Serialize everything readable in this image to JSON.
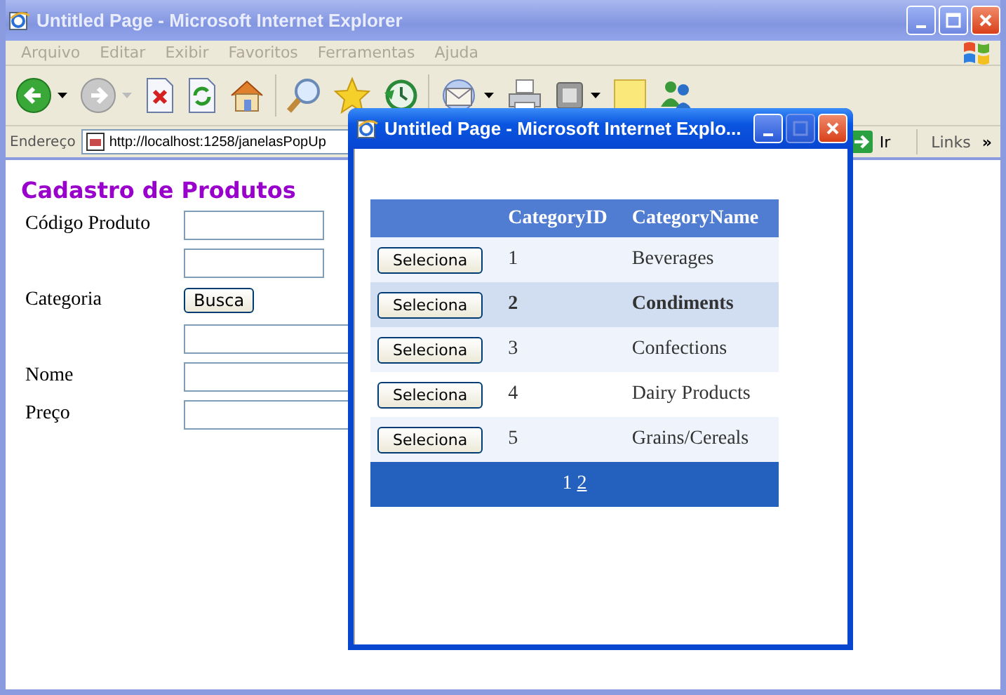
{
  "window": {
    "title": "Untitled Page - Microsoft Internet Explorer"
  },
  "menu": [
    {
      "label": "Arquivo",
      "disabled": true
    },
    {
      "label": "Editar",
      "disabled": true
    },
    {
      "label": "Exibir",
      "disabled": true
    },
    {
      "label": "Favoritos",
      "disabled": true
    },
    {
      "label": "Ferramentas",
      "disabled": true
    },
    {
      "label": "Ajuda",
      "disabled": true
    }
  ],
  "address_bar": {
    "label": "Endereço",
    "value": "http://localhost:1258/janelasPopUp",
    "go_label": "Ir",
    "links_label": "Links",
    "chevron": "»"
  },
  "page": {
    "heading": "Cadastro de Produtos",
    "rows": [
      {
        "label": "Código Produto",
        "kind": "short_input"
      },
      {
        "kind": "short_input"
      },
      {
        "label": "Categoria",
        "kind": "button",
        "button": "Busca"
      },
      {
        "kind": "input"
      },
      {
        "label": "Nome",
        "kind": "input"
      },
      {
        "label": "Preço",
        "kind": "input"
      }
    ]
  },
  "popup": {
    "title": "Untitled Page - Microsoft Internet Explo...",
    "table": {
      "columns": [
        "CategoryID",
        "CategoryName"
      ],
      "rows": [
        {
          "button": "Seleciona",
          "id": "1",
          "name": "Beverages",
          "selected": false
        },
        {
          "button": "Seleciona",
          "id": "2",
          "name": "Condiments",
          "selected": true
        },
        {
          "button": "Seleciona",
          "id": "3",
          "name": "Confections",
          "selected": false
        },
        {
          "button": "Seleciona",
          "id": "4",
          "name": "Dairy Products",
          "selected": false
        },
        {
          "button": "Seleciona",
          "id": "5",
          "name": "Grains/Cereals",
          "selected": false
        }
      ],
      "pager": [
        {
          "label": "1",
          "current": true
        },
        {
          "label": "2",
          "current": false
        }
      ]
    }
  }
}
